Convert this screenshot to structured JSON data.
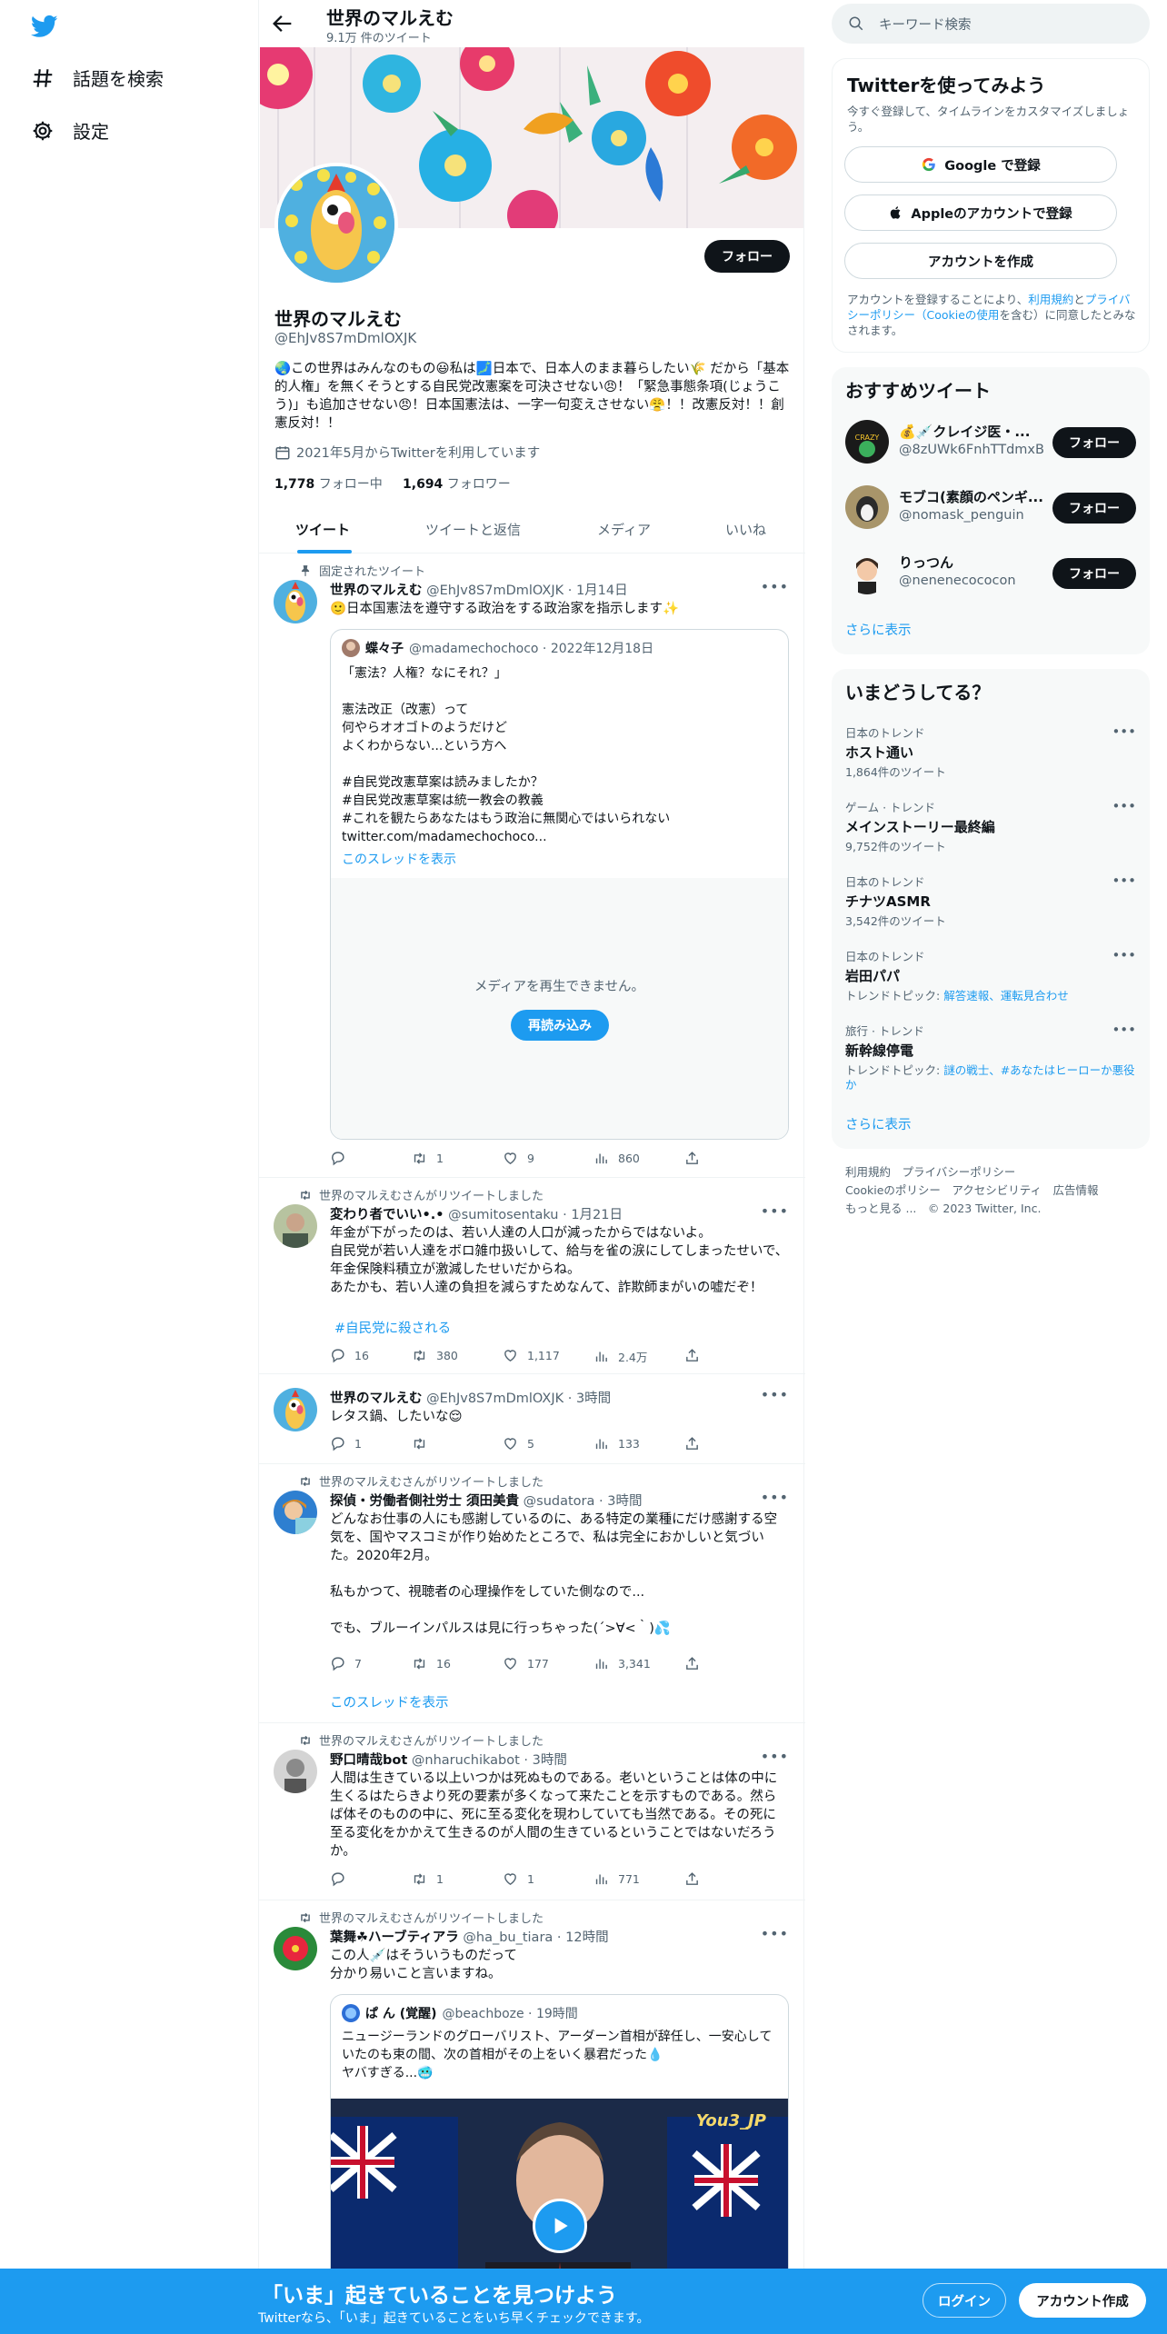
{
  "colors": {
    "accent": "#1d9bf0",
    "text": "#0f1419",
    "muted": "#536471"
  },
  "nav": {
    "logo_icon": "twitter-bird-icon",
    "explore": "話題を検索",
    "settings": "設定"
  },
  "header": {
    "name": "世界のマルえむ",
    "tweet_count": "9.1万 件のツイート"
  },
  "profile": {
    "follow_label": "フォロー",
    "name": "世界のマルえむ",
    "handle": "@EhJv8S7mDmlOXJK",
    "bio": "🌏この世界はみんなのもの😃私は🗾日本で、日本人のまま暮らしたい🌾 だから「基本的人権」を無くそうとする自民党改憲案を可決させない😠！「緊急事態条項(じょうこう)」も追加させない😠！日本国憲法は、一字一句変えさせない😤！！改憲反対！！創憲反対！！",
    "joined": "2021年5月からTwitterを利用しています",
    "following_count": "1,778",
    "following_label": "フォロー中",
    "followers_count": "1,694",
    "followers_label": "フォロワー"
  },
  "tabs": [
    "ツイート",
    "ツイートと返信",
    "メディア",
    "いいね"
  ],
  "tweets": [
    {
      "context": "固定されたツイート",
      "name": "世界のマルえむ",
      "handle_time": "@EhJv8S7mDmlOXJK · 1月14日",
      "text": "🙂日本国憲法を遵守する政治をする政治家を指示します✨",
      "quote": {
        "name": "蝶々子",
        "handle_time": "@madamechochoco · 2022年12月18日",
        "text": "「憲法？人権？なにそれ？」\n\n憲法改正（改憲）って\n何やらオオゴトのようだけど\nよくわからない...という方へ\n\n#自民党改憲草案は読みましたか？\n#自民党改憲草案は統一教会の教義\n#これを観たらあなたはもう政治に無関心ではいられない\ntwitter.com/madamechochoco...",
        "thread_link": "このスレッドを表示",
        "media_message": "メディアを再生できません。",
        "reload_label": "再読み込み"
      },
      "stats": {
        "reply": "",
        "retweet": "1",
        "like": "9",
        "views": "860"
      }
    },
    {
      "context": "世界のマルえむさんがリツイートしました",
      "name": "変わり者でいい•.•",
      "handle_time": "@sumitosentaku · 1月21日",
      "text": "年金が下がったのは、若い人達の人口が減ったからではないよ。\n自民党が若い人達をボロ雑巾扱いして、給与を雀の涙にしてしまったせいで、年金保険料積立が激減したせいだからね。\nあたかも、若い人達の負担を減らすためなんて、詐欺師まがいの嘘だぞ！",
      "hashtag": "#自民党に殺される",
      "stats": {
        "reply": "16",
        "retweet": "380",
        "like": "1,117",
        "views": "2.4万"
      }
    },
    {
      "context": "",
      "name": "世界のマルえむ",
      "handle_time": "@EhJv8S7mDmlOXJK · 3時間",
      "text": "レタス鍋、したいな😌",
      "stats": {
        "reply": "1",
        "retweet": "",
        "like": "5",
        "views": "133"
      }
    },
    {
      "context": "世界のマルえむさんがリツイートしました",
      "name": "探偵・労働者側社労士 須田美貴",
      "handle_time": "@sudatora · 3時間",
      "text": "どんなお仕事の人にも感謝しているのに、ある特定の業種にだけ感謝する空気を、国やマスコミが作り始めたところで、私は完全におかしいと気づいた。2020年2月。\n\n私もかつて、視聴者の心理操作をしていた側なので...\n\nでも、ブルーインパルスは見に行っちゃった(´>∀<｀)💦",
      "thread_link": "このスレッドを表示",
      "stats": {
        "reply": "7",
        "retweet": "16",
        "like": "177",
        "views": "3,341"
      }
    },
    {
      "context": "世界のマルえむさんがリツイートしました",
      "name": "野口晴哉bot",
      "handle_time": "@nharuchikabot · 3時間",
      "text": "人間は生きている以上いつかは死ぬものである。老いということは体の中に生くるはたらきより死の要素が多くなって来たことを示すものである。然らば体そのものの中に、死に至る変化を現わしていても当然である。その死に至る変化をかかえて生きるのが人間の生きているということではないだろうか。",
      "stats": {
        "reply": "",
        "retweet": "1",
        "like": "1",
        "views": "771"
      }
    },
    {
      "context": "世界のマルえむさんがリツイートしました",
      "name": "葉舞☘ハーブティアラ",
      "handle_time": "@ha_bu_tiara · 12時間",
      "text": "この人💉はそういうものだって\n分かり易いこと言いますね。",
      "quote": {
        "name": "ぱ ん (覚醒)",
        "handle_time": "@beachboze · 19時間",
        "text": "ニュージーランドのグローバリスト、アーダーン首相が辞任し、一安心していたのも束の間、次の首相がその上をいく暴君だった💧\nヤバすぎる...🥶",
        "watermark": "You3_JP"
      }
    }
  ],
  "right": {
    "search_placeholder": "キーワード検索",
    "signup": {
      "title": "Twitterを使ってみよう",
      "subtitle": "今すぐ登録して、タイムラインをカスタマイズしましょう。",
      "google": "Google で登録",
      "apple": "Appleのアカウントで登録",
      "create": "アカウントを作成",
      "legal_1": "アカウントを登録することにより、",
      "legal_link_1": "利用規約",
      "legal_2": "と",
      "legal_link_2": "プライバシーポリシー（Cookieの使用",
      "legal_3": "を含む）に同意したとみなされます。"
    },
    "recommended": {
      "title": "おすすめツイート",
      "follow_label": "フォロー",
      "accounts": [
        {
          "name": "💰💉クレイジ医・...",
          "handle": "@8zUWk6FnhTTdmxB"
        },
        {
          "name": "モブコ(素顔のペンギ...",
          "handle": "@nomask_penguin"
        },
        {
          "name": "りっつん",
          "handle": "@nenenecococon"
        }
      ],
      "more": "さらに表示"
    },
    "trends": {
      "title": "いまどうしてる？",
      "items": [
        {
          "meta": "日本のトレンド",
          "title": "ホスト通い",
          "sub": "1,864件のツイート"
        },
        {
          "meta": "ゲーム · トレンド",
          "title": "メインストーリー最終編",
          "sub": "9,752件のツイート"
        },
        {
          "meta": "日本のトレンド",
          "title": "チナツASMR",
          "sub": "3,542件のツイート"
        },
        {
          "meta": "日本のトレンド",
          "title": "岩田パパ",
          "sub_prefix": "トレンドトピック: ",
          "sub_links": "解答速報、運転見合わせ"
        },
        {
          "meta": "旅行 · トレンド",
          "title": "新幹線停電",
          "sub_prefix": "トレンドトピック: ",
          "sub_links": "謎の戦士、#あなたはヒーローか悪役か"
        }
      ],
      "more": "さらに表示"
    },
    "footer": {
      "line1": "利用規約　プライバシーポリシー",
      "line2": "Cookieのポリシー　アクセシビリティ　広告情報",
      "line3": "もっと見る ...　© 2023 Twitter, Inc."
    }
  },
  "bottom_bar": {
    "title": "「いま」起きていることを見つけよう",
    "subtitle": "Twitterなら、「いま」起きていることをいち早くチェックできます。",
    "login": "ログイン",
    "signup": "アカウント作成"
  }
}
